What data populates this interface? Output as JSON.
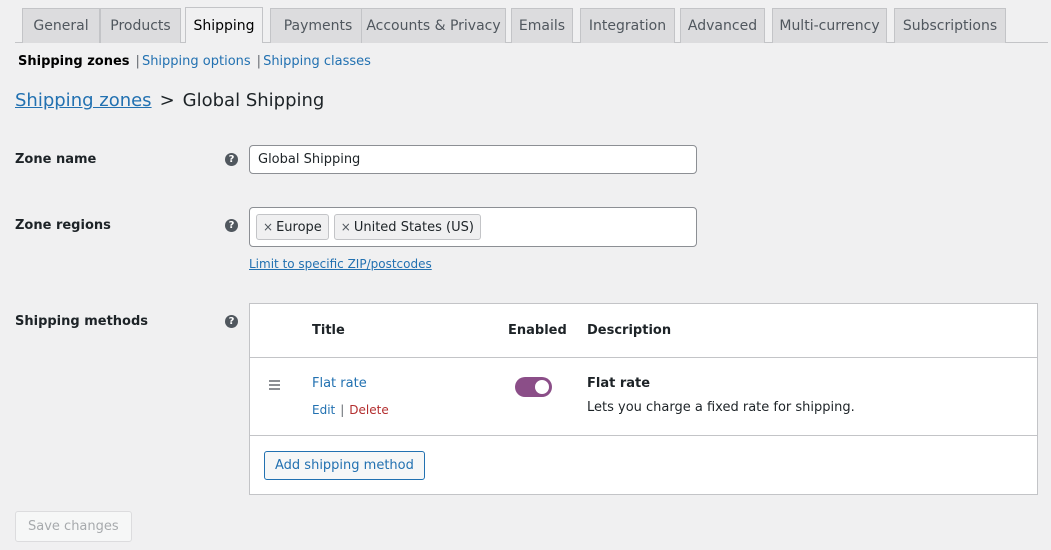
{
  "tabs": [
    {
      "label": "General"
    },
    {
      "label": "Products"
    },
    {
      "label": "Shipping",
      "active": true
    },
    {
      "label": "Payments"
    },
    {
      "label": "Accounts & Privacy"
    },
    {
      "label": "Emails"
    },
    {
      "label": "Integration"
    },
    {
      "label": "Advanced"
    },
    {
      "label": "Multi-currency"
    },
    {
      "label": "Subscriptions"
    }
  ],
  "subnav": {
    "current": "Shipping zones",
    "separator": "|",
    "options": "Shipping options",
    "classes": "Shipping classes"
  },
  "heading": {
    "link": "Shipping zones",
    "separator": ">",
    "current": "Global Shipping"
  },
  "zone_name": {
    "label": "Zone name",
    "value": "Global Shipping"
  },
  "zone_regions": {
    "label": "Zone regions",
    "chips": [
      {
        "remove": "×",
        "label": "Europe"
      },
      {
        "remove": "×",
        "label": "United States (US)"
      }
    ],
    "limit_link": "Limit to specific ZIP/postcodes"
  },
  "help_glyph": "?",
  "shipping_methods": {
    "label": "Shipping methods",
    "headers": {
      "title": "Title",
      "enabled": "Enabled",
      "description": "Description"
    },
    "rows": [
      {
        "title": "Flat rate",
        "edit": "Edit",
        "separator": "|",
        "delete": "Delete",
        "enabled": true,
        "desc_title": "Flat rate",
        "desc_text": "Lets you charge a fixed rate for shipping."
      }
    ],
    "add_button": "Add shipping method"
  },
  "save_button": "Save changes",
  "colors": {
    "link": "#2271b1",
    "delete": "#b32d2e",
    "toggle_on": "#8b4e88"
  }
}
